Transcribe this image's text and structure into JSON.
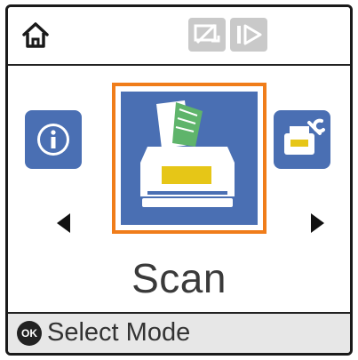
{
  "topbar": {
    "home_icon": "home-icon",
    "status_icons": [
      "wifi-direct-icon",
      "playback-icon"
    ]
  },
  "modes": {
    "left_icon": "info-icon",
    "selected_icon": "scanner-icon",
    "right_icon": "printer-settings-icon",
    "selected_label": "Scan"
  },
  "footer": {
    "ok_badge": "OK",
    "hint": "Select Mode"
  },
  "colors": {
    "tile_blue": "#4a6fb3",
    "selection_orange": "#f07d1a",
    "status_gray": "#c9c9c9",
    "footer_gray": "#e7e7e7"
  }
}
